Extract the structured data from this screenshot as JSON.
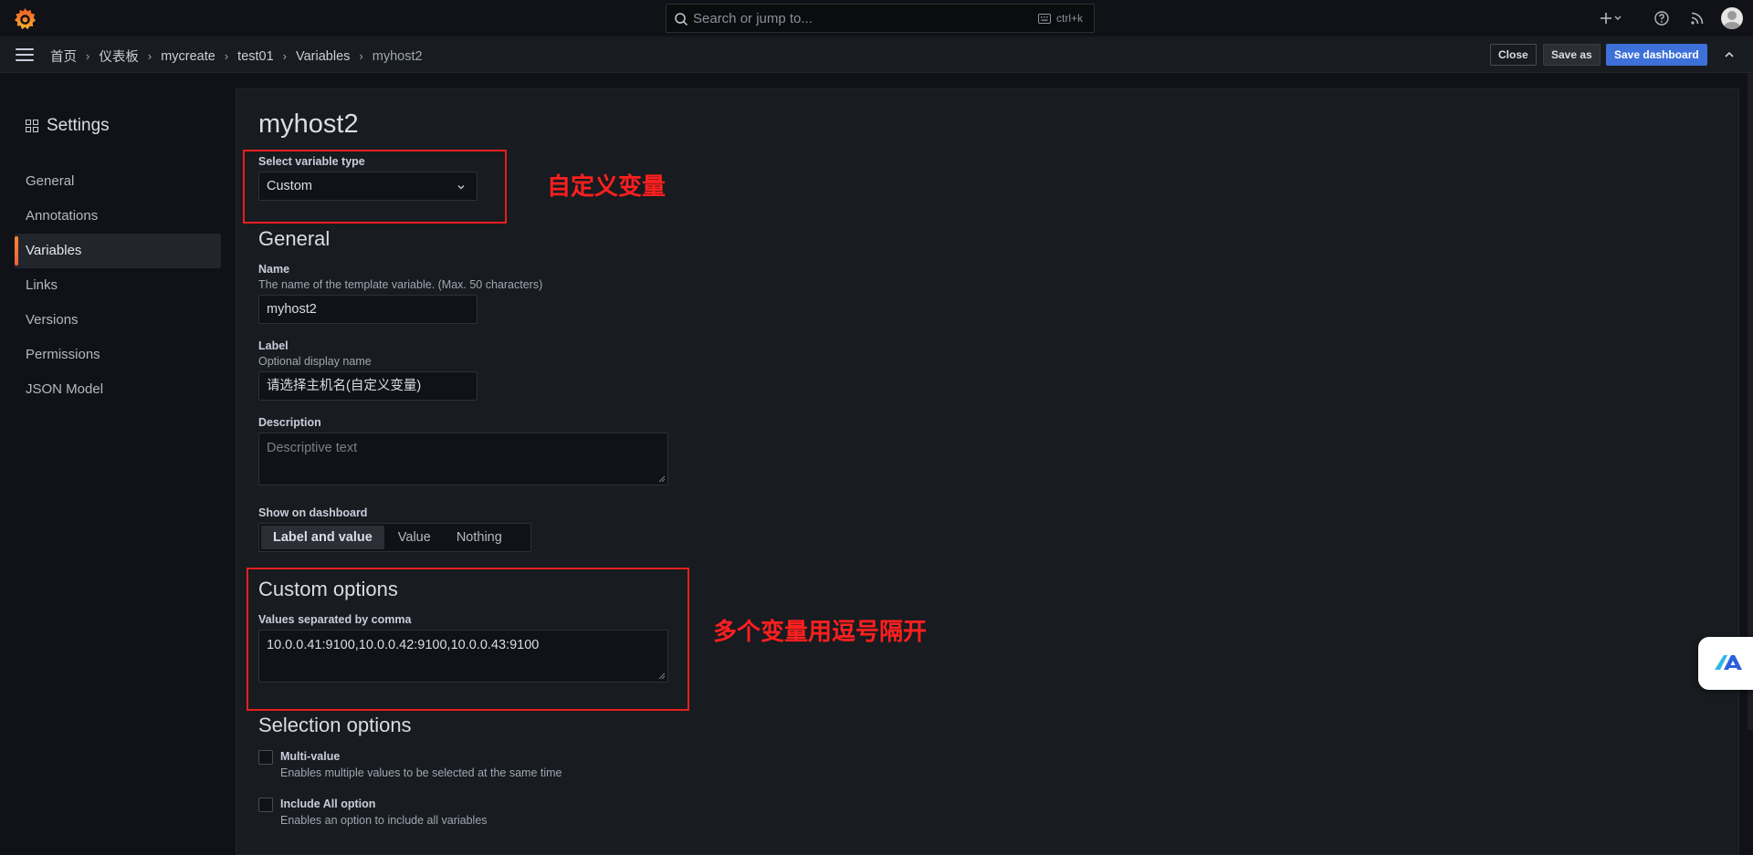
{
  "topbar": {
    "search_placeholder": "Search or jump to...",
    "search_shortcut": "ctrl+k",
    "icons": [
      "grafana-logo-icon",
      "search-icon",
      "keyboard-icon",
      "plus-icon",
      "chevron-down-icon",
      "help-icon",
      "rss-icon",
      "avatar"
    ]
  },
  "breadcrumb": {
    "items": [
      "首页",
      "仪表板",
      "mycreate",
      "test01",
      "Variables",
      "myhost2"
    ],
    "separator": "›"
  },
  "actions": {
    "close": "Close",
    "save_as": "Save as",
    "save_dashboard": "Save dashboard"
  },
  "sidebar": {
    "title": "Settings",
    "items": [
      {
        "label": "General",
        "active": false
      },
      {
        "label": "Annotations",
        "active": false
      },
      {
        "label": "Variables",
        "active": true
      },
      {
        "label": "Links",
        "active": false
      },
      {
        "label": "Versions",
        "active": false
      },
      {
        "label": "Permissions",
        "active": false
      },
      {
        "label": "JSON Model",
        "active": false
      }
    ]
  },
  "editor": {
    "title": "myhost2",
    "type_label": "Select variable type",
    "type_value": "Custom",
    "general_heading": "General",
    "name_label": "Name",
    "name_desc": "The name of the template variable. (Max. 50 characters)",
    "name_value": "myhost2",
    "label_label": "Label",
    "label_desc": "Optional display name",
    "label_value": "请选择主机名(自定义变量)",
    "description_label": "Description",
    "description_placeholder": "Descriptive text",
    "show_label": "Show on dashboard",
    "show_options": [
      "Label and value",
      "Value",
      "Nothing"
    ],
    "show_selected": "Label and value",
    "custom_heading": "Custom options",
    "values_label": "Values separated by comma",
    "values_value": "10.0.0.41:9100,10.0.0.42:9100,10.0.0.43:9100",
    "selection_heading": "Selection options",
    "multi_label": "Multi-value",
    "multi_desc": "Enables multiple values to be selected at the same time",
    "includeall_label": "Include All option",
    "includeall_desc": "Enables an option to include all variables"
  },
  "annotations": {
    "note1": "自定义变量",
    "note2": "多个变量用逗号隔开",
    "color": "#e51f1f"
  },
  "colors": {
    "background": "#111217",
    "panel": "#181b1f",
    "primary_button": "#3d71d9",
    "active_accent": "#f55f3e"
  }
}
